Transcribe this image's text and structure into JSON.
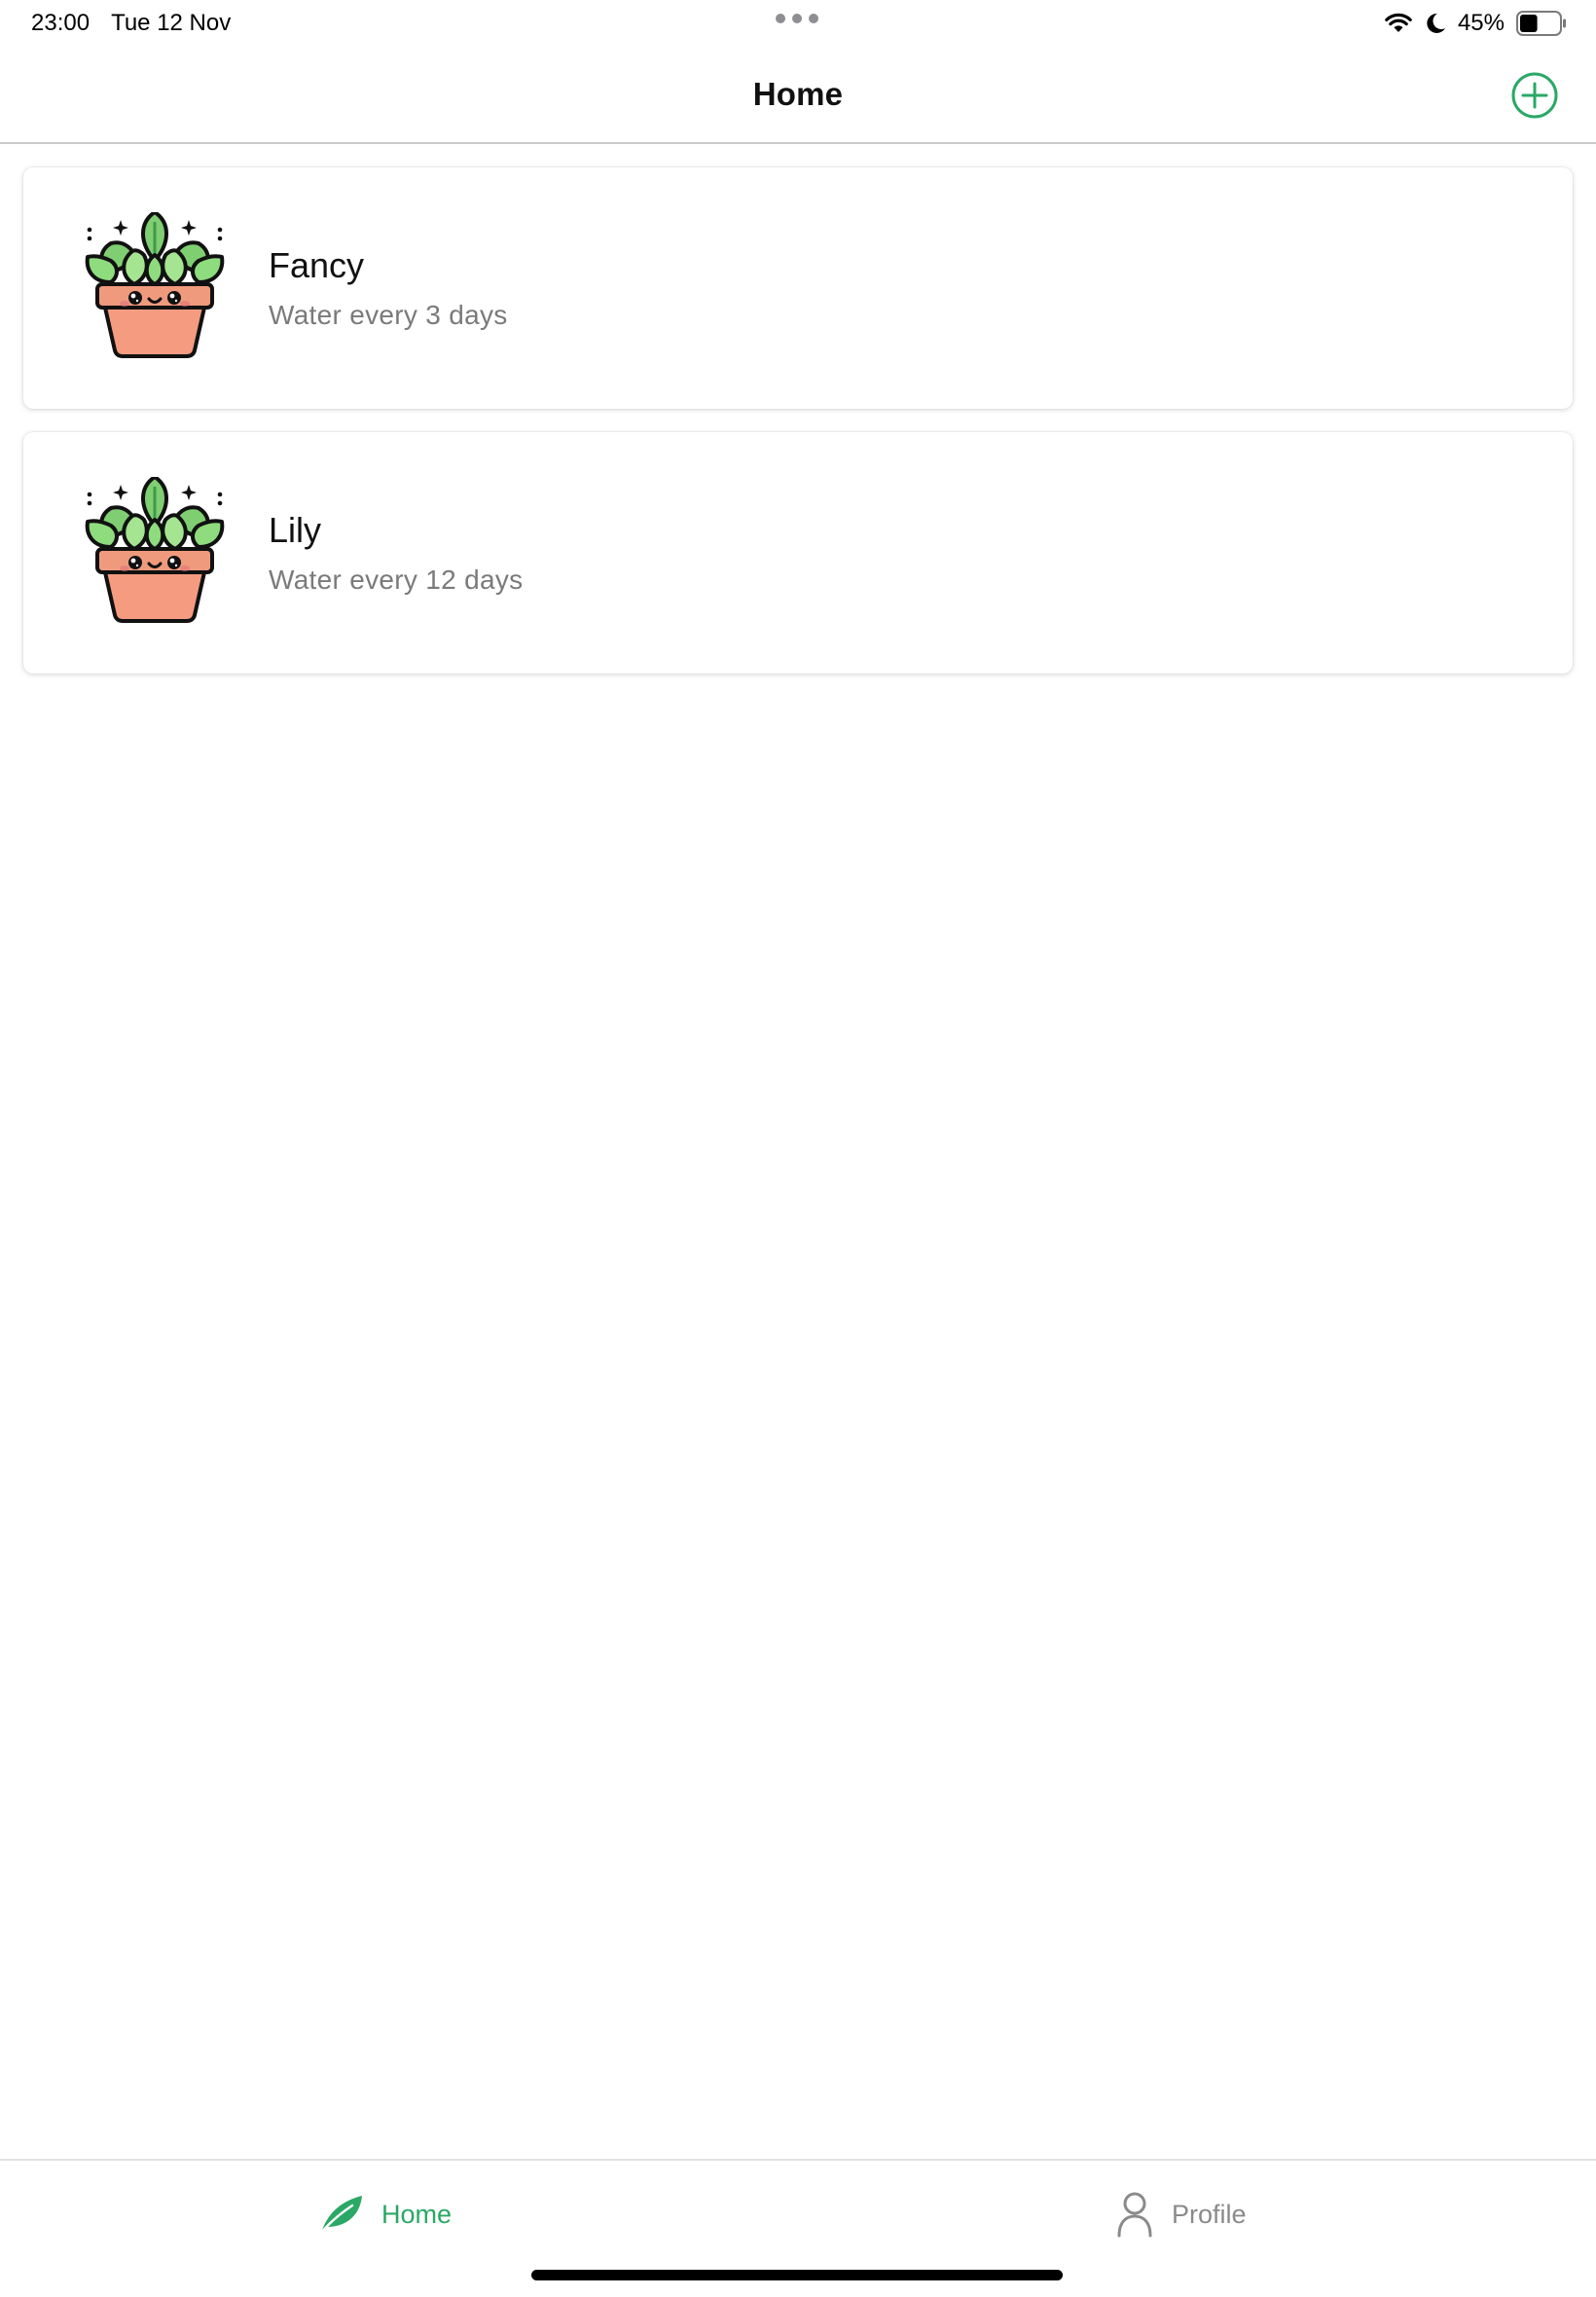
{
  "status_bar": {
    "time": "23:00",
    "date": "Tue 12 Nov",
    "battery_text": "45%",
    "battery_level": 0.45,
    "icons": [
      "wifi-icon",
      "moon-icon",
      "battery-icon"
    ]
  },
  "nav": {
    "title": "Home",
    "add_icon": "plus-circle-icon"
  },
  "plants": [
    {
      "name": "Fancy",
      "schedule": "Water every 3 days",
      "icon": "potted-plant-icon"
    },
    {
      "name": "Lily",
      "schedule": "Water every 12 days",
      "icon": "potted-plant-icon"
    }
  ],
  "tabs": [
    {
      "label": "Home",
      "icon": "leaf-icon",
      "active": true
    },
    {
      "label": "Profile",
      "icon": "person-icon",
      "active": false
    }
  ],
  "colors": {
    "accent": "#2aa865",
    "inactive": "#8a8a8a",
    "subtitle": "#7a7a7a"
  }
}
